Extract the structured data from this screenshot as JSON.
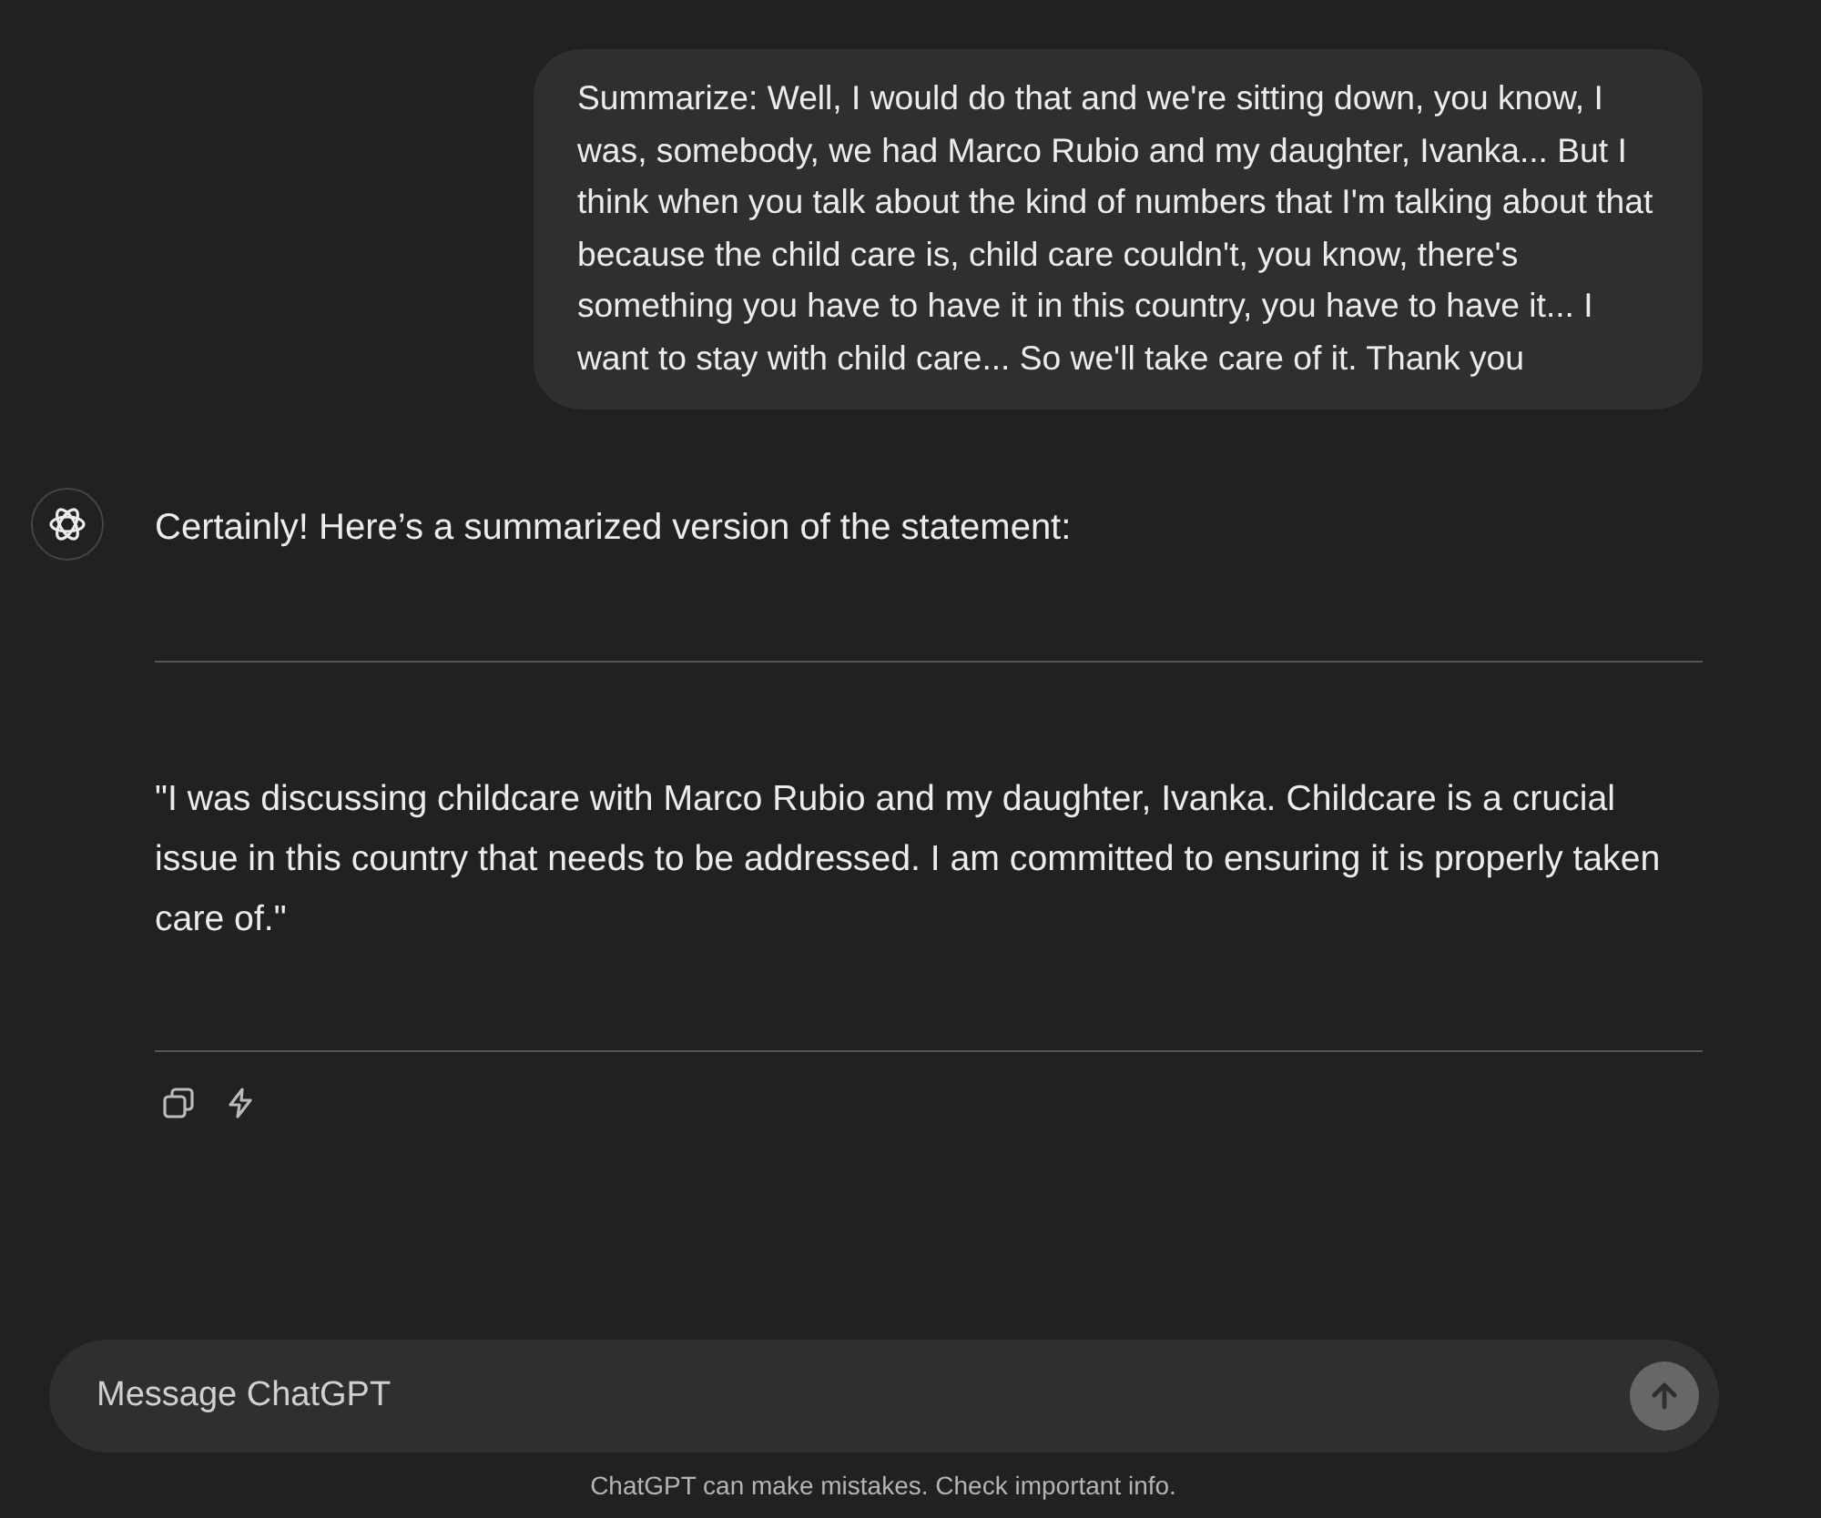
{
  "user_message": "Summarize: Well, I would do that and we're sitting down, you know, I was, somebody, we had Marco Rubio and my daughter, Ivanka... But I think when you talk about the kind of numbers that I'm talking about that because the child care is, child care couldn't, you know, there's something you have to have it in this country, you have to have it... I want to stay with child care... So we'll take care of it. Thank you",
  "assistant_message": {
    "intro": "Certainly! Here’s a summarized version of the statement:",
    "quote": "\"I was discussing childcare with Marco Rubio and my daughter, Ivanka. Childcare is a crucial issue in this country that needs to be addressed. I am committed to ensuring it is properly taken care of.\""
  },
  "composer": {
    "placeholder": "Message ChatGPT",
    "send_disabled": true
  },
  "footer": "ChatGPT can make mistakes. Check important info."
}
